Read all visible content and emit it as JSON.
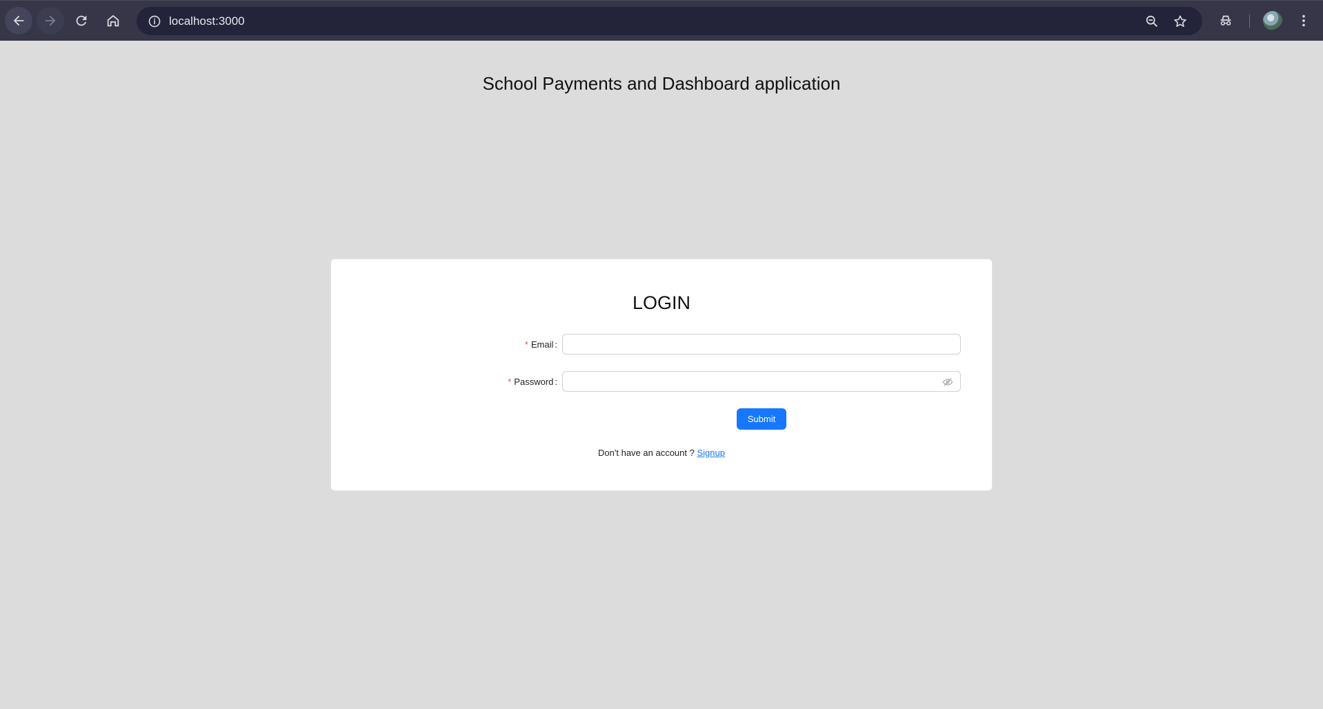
{
  "browser": {
    "url": "localhost:3000",
    "icons": [
      "back-icon",
      "forward-icon",
      "reload-icon",
      "home-icon",
      "info-icon",
      "zoom-icon",
      "star-icon",
      "incognito-icon",
      "avatar",
      "kebab-menu-icon"
    ]
  },
  "page": {
    "title": "School Payments and Dashboard application"
  },
  "login": {
    "heading": "LOGIN",
    "email_label": "Email",
    "email_value": "",
    "password_label": "Password",
    "password_value": "",
    "required_mark": "*",
    "colon": ":",
    "submit_label": "Submit",
    "signup_prompt": "Don't have an account ?",
    "signup_link": "Signup"
  },
  "colors": {
    "page_background": "#dcdcdc",
    "primary": "#1677ff",
    "required": "#ff4d4f",
    "chrome_background": "#363648",
    "omnibox_background": "#23233a"
  }
}
